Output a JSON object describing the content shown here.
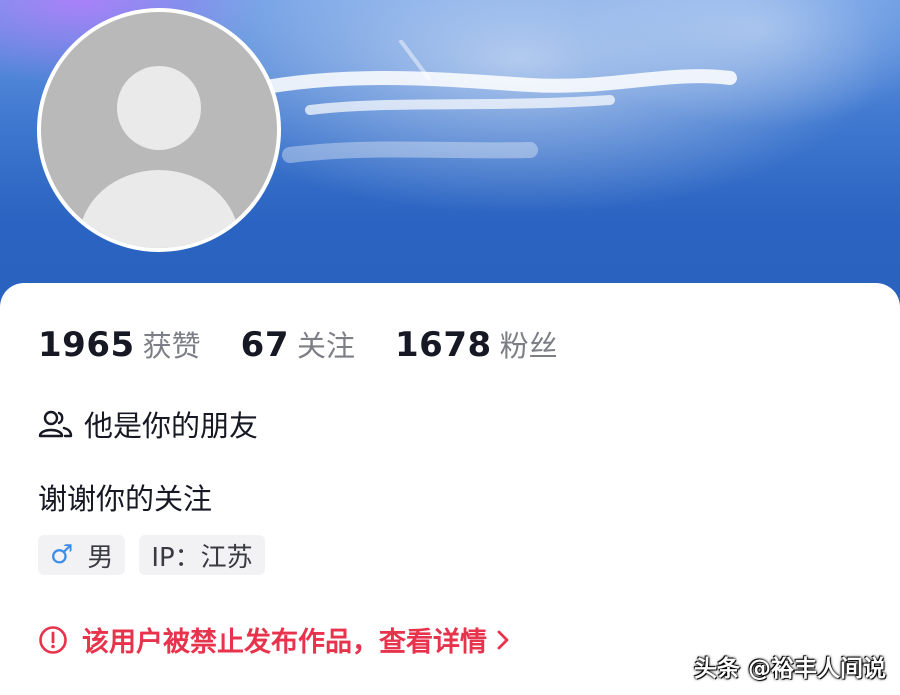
{
  "profile": {
    "stats": [
      {
        "value": "1965",
        "label": "获赞"
      },
      {
        "value": "67",
        "label": "关注"
      },
      {
        "value": "1678",
        "label": "粉丝"
      }
    ],
    "friend_status": "他是你的朋友",
    "bio": "谢谢你的关注",
    "tags": {
      "gender": "男",
      "ip": "IP：江苏"
    },
    "banned_notice": "该用户被禁止发布作品，查看详情"
  },
  "watermark": "头条 @裕丰人间说",
  "colors": {
    "banner_blue": "#2a63c1",
    "warning_red": "#e8334d",
    "gender_blue": "#3b8de8"
  },
  "icons": [
    "avatar-placeholder",
    "friends-icon",
    "male-icon",
    "alert-circle-icon",
    "chevron-right-icon"
  ]
}
